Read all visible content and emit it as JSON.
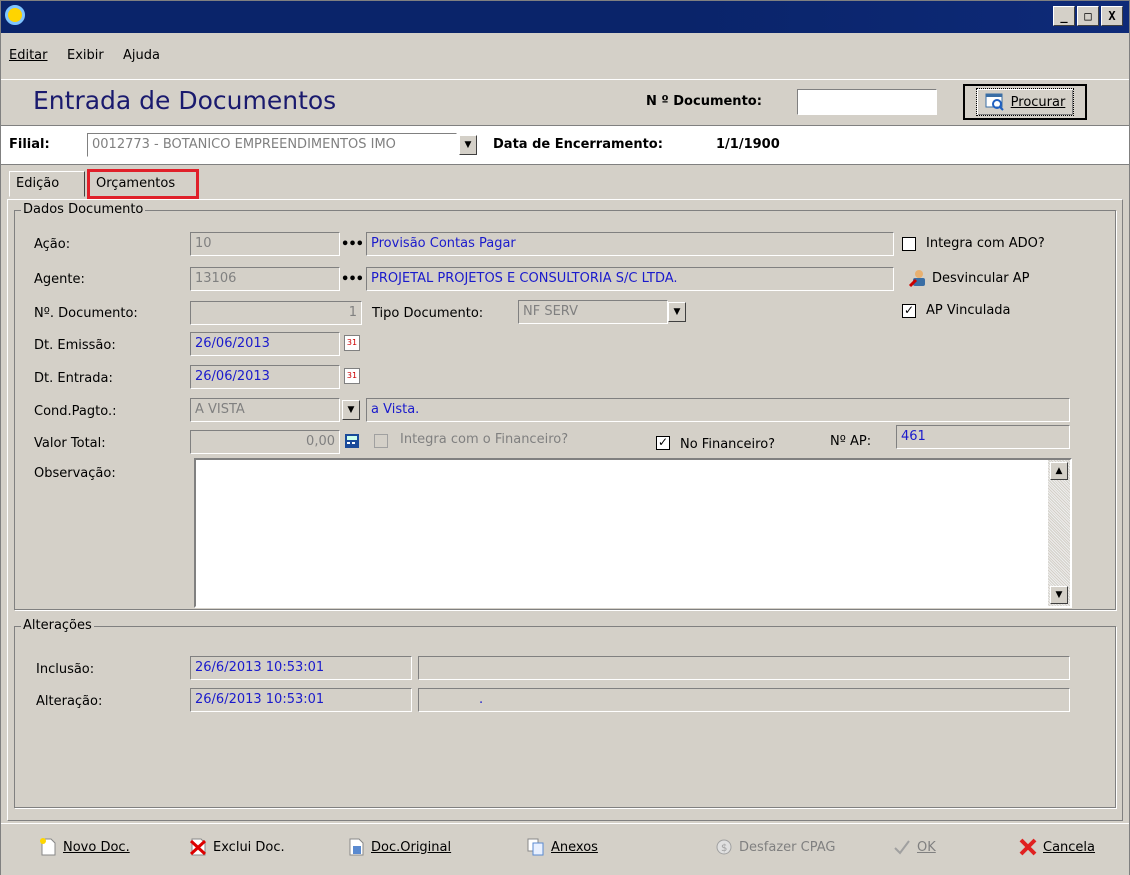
{
  "menu": {
    "items": [
      "Editar",
      "Exibir",
      "Ajuda"
    ]
  },
  "window_buttons": [
    "_",
    "□",
    "X"
  ],
  "header": {
    "title": "Entrada de Documentos",
    "ndoc_label": "N º Documento:",
    "ndoc_value": "",
    "search_button": "Procurar"
  },
  "filial": {
    "label": "Filial:",
    "value": "0012773 - BOTANICO EMPREENDIMENTOS IMO",
    "data_encerramento_label": "Data de Encerramento:",
    "data_encerramento_value": "1/1/1900"
  },
  "tabs": [
    {
      "label": "Edição",
      "selected": true
    },
    {
      "label": "Orçamentos",
      "selected": false,
      "highlighted": true
    }
  ],
  "dados": {
    "group_title": "Dados Documento",
    "acao_label": "Ação:",
    "acao_code": "10",
    "acao_desc": "Provisão Contas Pagar",
    "agente_label": "Agente:",
    "agente_code": "13106",
    "agente_desc": "PROJETAL PROJETOS E CONSULTORIA S/C LTDA.",
    "ndoc_label": "Nº. Documento:",
    "ndoc_value": "1",
    "tipo_label": "Tipo Documento:",
    "tipo_value": "NF SERV",
    "emissao_label": "Dt. Emissão:",
    "emissao_value": "26/06/2013",
    "entrada_label": "Dt. Entrada:",
    "entrada_value": "26/06/2013",
    "cond_label": "Cond.Pagto.:",
    "cond_value": "A VISTA",
    "cond_desc": "a Vista.",
    "valor_label": "Valor Total:",
    "valor_value": "0,00",
    "integra_fin_label": "Integra com o Financeiro?",
    "integra_fin_checked": false,
    "no_fin_label": "No Financeiro?",
    "no_fin_checked": true,
    "nap_label": "Nº AP:",
    "nap_value": "461",
    "obs_label": "Observação:",
    "obs_value": "",
    "integra_ado_label": "Integra com ADO?",
    "integra_ado_checked": false,
    "desvincular_label": "Desvincular AP",
    "ap_vinculada_label": "AP Vinculada",
    "ap_vinculada_checked": true
  },
  "alteracoes": {
    "group_title": "Alterações",
    "inclusao_label": "Inclusão:",
    "inclusao_value": "26/6/2013 10:53:01",
    "inclusao_user": "",
    "alteracao_label": "Alteração:",
    "alteracao_value": "26/6/2013 10:53:01",
    "alteracao_user": "."
  },
  "footer": {
    "novo": "Novo Doc.",
    "exclui": "Exclui Doc.",
    "original": "Doc.Original",
    "anexos": "Anexos",
    "desfazer": "Desfazer CPAG",
    "ok": "OK",
    "cancela": "Cancela"
  },
  "colors": {
    "title_bar": "#0a246a",
    "accent_blue": "#1a1acc",
    "highlight_red": "#e0202a",
    "face": "#d4d0c8"
  }
}
